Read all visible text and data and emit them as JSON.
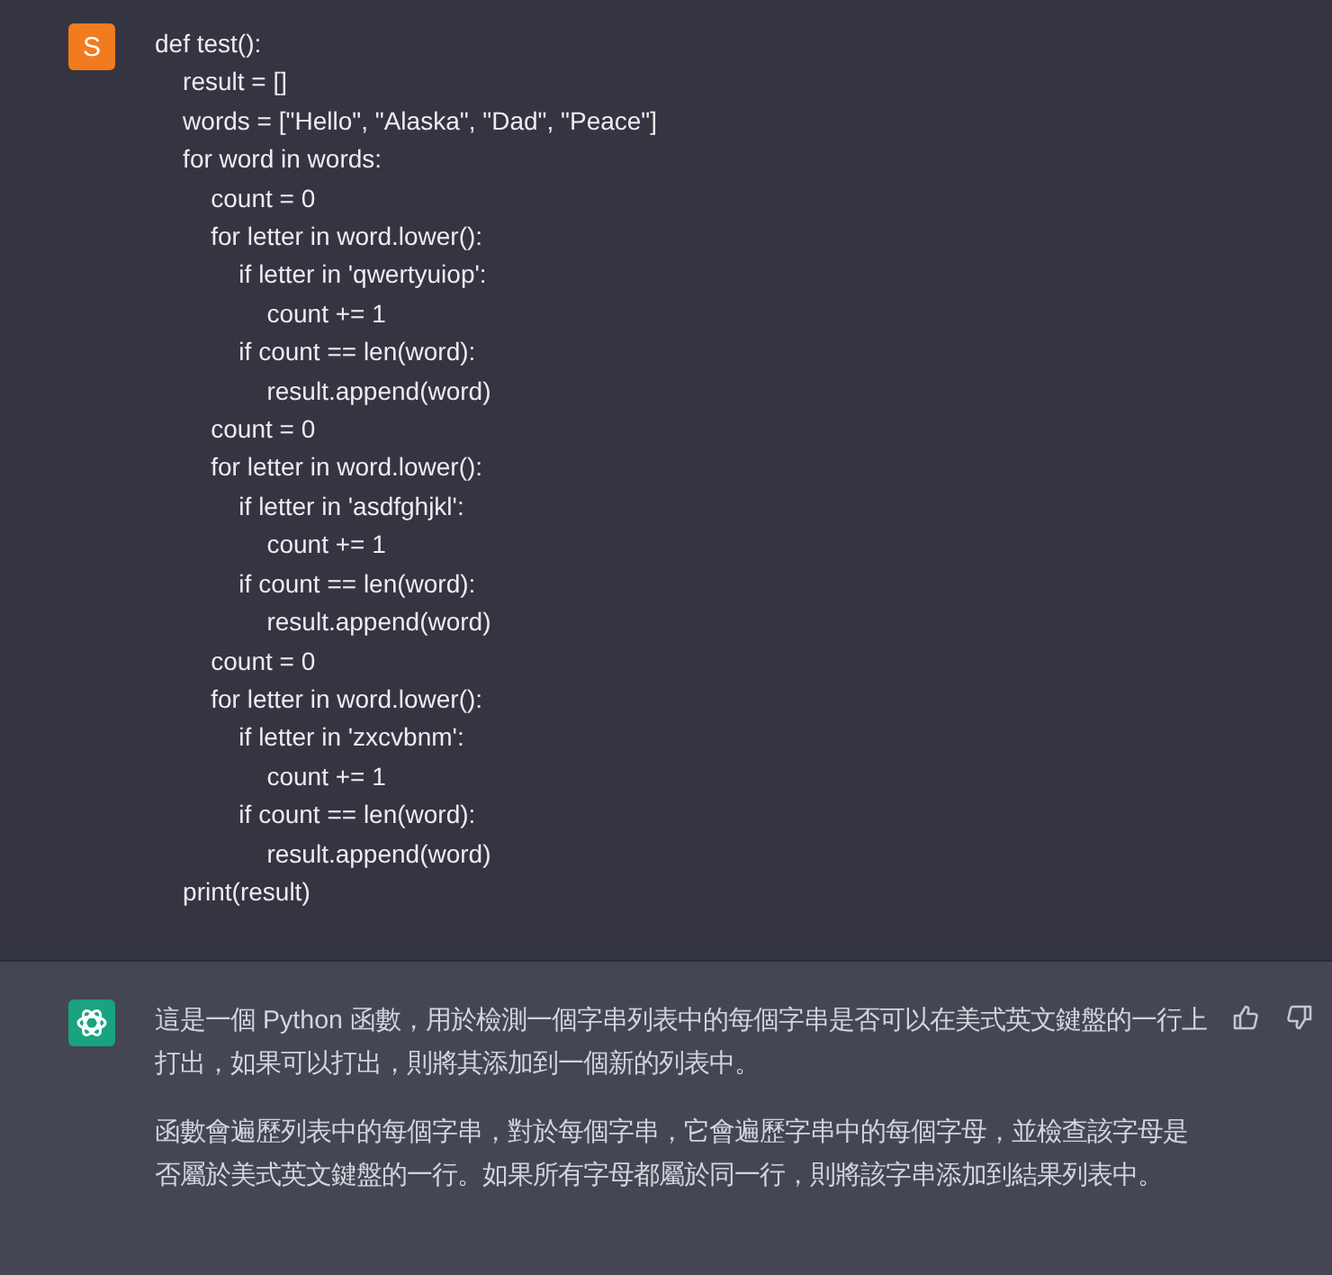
{
  "messages": [
    {
      "kind": "user",
      "avatar": "S",
      "code_lines": [
        "def test():",
        "    result = []",
        "    words = [\"Hello\", \"Alaska\", \"Dad\", \"Peace\"]",
        "    for word in words:",
        "        count = 0",
        "        for letter in word.lower():",
        "            if letter in 'qwertyuiop':",
        "                count += 1",
        "            if count == len(word):",
        "                result.append(word)",
        "        count = 0",
        "        for letter in word.lower():",
        "            if letter in 'asdfghjkl':",
        "                count += 1",
        "            if count == len(word):",
        "                result.append(word)",
        "        count = 0",
        "        for letter in word.lower():",
        "            if letter in 'zxcvbnm':",
        "                count += 1",
        "            if count == len(word):",
        "                result.append(word)",
        "    print(result)"
      ]
    },
    {
      "kind": "assistant",
      "paragraphs": [
        "這是一個 Python 函數，用於檢測一個字串列表中的每個字串是否可以在美式英文鍵盤的一行上打出，如果可以打出，則將其添加到一個新的列表中。",
        "函數會遍歷列表中的每個字串，對於每個字串，它會遍歷字串中的每個字母，並檢查該字母是否屬於美式英文鍵盤的一行。如果所有字母都屬於同一行，則將該字串添加到結果列表中。"
      ]
    }
  ]
}
